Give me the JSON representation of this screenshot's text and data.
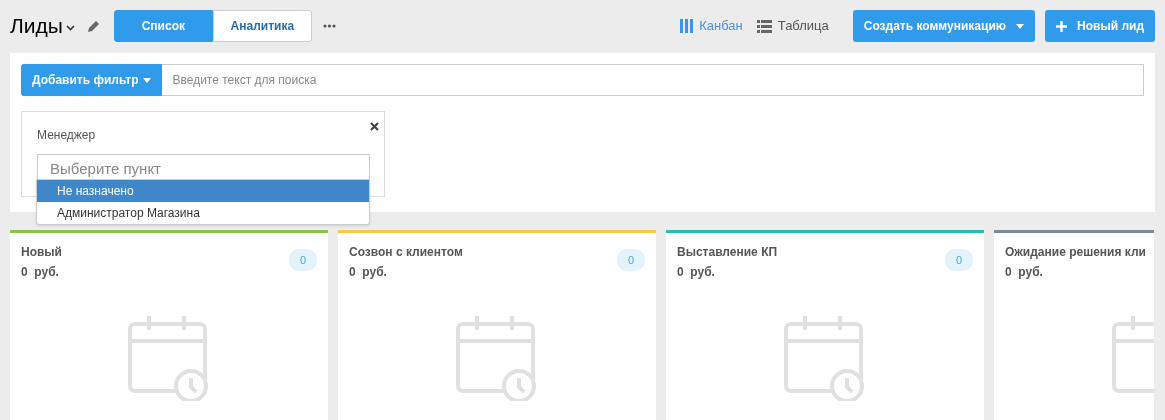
{
  "page_title": "Лиды",
  "tabs": [
    {
      "label": "Список",
      "selected": true
    },
    {
      "label": "Аналитика",
      "selected": false
    }
  ],
  "views": [
    {
      "label": "Канбан",
      "kind": "kanban",
      "selected": true
    },
    {
      "label": "Таблица",
      "kind": "table",
      "selected": false
    }
  ],
  "buttons": [
    {
      "label": "Создать коммуникацию",
      "kind": "dropdown"
    },
    {
      "label": "Новый лид",
      "kind": "add"
    }
  ],
  "filter_bar": {
    "button": "Добавить фильтр",
    "search_placeholder": "Введите текст для поиска"
  },
  "filter_card": {
    "label": "Менеджер",
    "placeholder": "Выберите пункт",
    "options": [
      {
        "label": "Не назначено",
        "selected": true
      },
      {
        "label": "Администратор Магазина",
        "selected": false
      }
    ]
  },
  "columns": [
    {
      "title": "Новый",
      "sum": "0  руб.",
      "count": "0",
      "color": "#8bc34a"
    },
    {
      "title": "Созвон с клиентом",
      "sum": "0  руб.",
      "count": "0",
      "color": "#f9c846"
    },
    {
      "title": "Выставление КП",
      "sum": "0  руб.",
      "count": "0",
      "color": "#26bfad"
    },
    {
      "title": "Ожидание решения кли",
      "sum": "0  руб.",
      "color": "#7b8a97"
    }
  ]
}
